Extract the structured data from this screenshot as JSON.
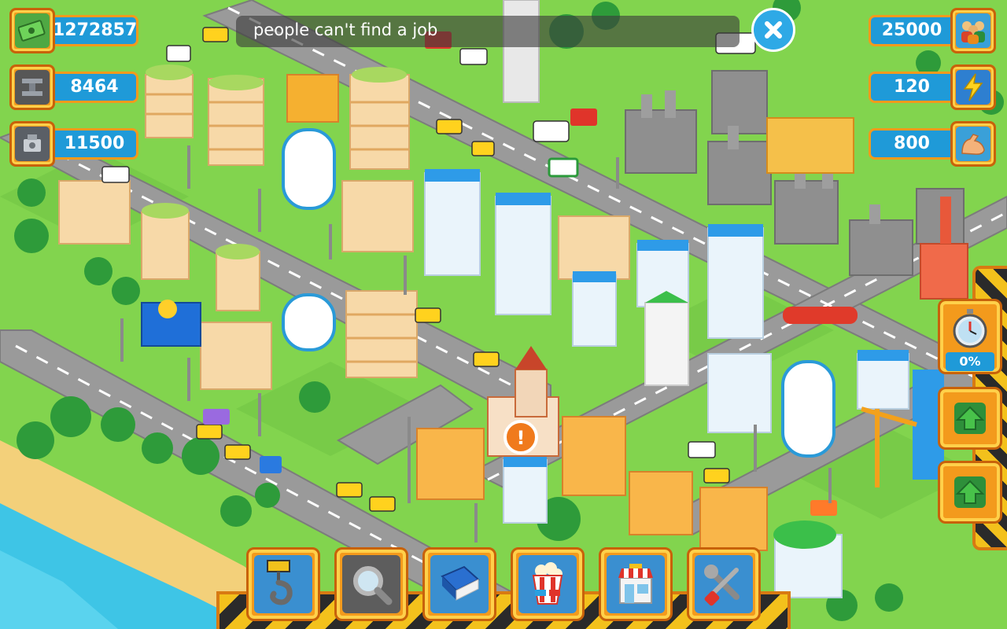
{
  "resources": {
    "money": {
      "value": "1272857",
      "icon": "money-icon"
    },
    "steel": {
      "value": "8464",
      "icon": "steel-beam-icon"
    },
    "machinery": {
      "value": "11500",
      "icon": "engine-icon"
    },
    "population": {
      "value": "25000",
      "icon": "people-icon"
    },
    "energy": {
      "value": "120",
      "icon": "lightning-icon"
    },
    "workforce": {
      "value": "800",
      "icon": "bicep-icon"
    }
  },
  "notification": {
    "message": "people can't find a job"
  },
  "side_panel": {
    "timer_percent": "0%"
  },
  "toolbar": [
    {
      "id": "build",
      "icon": "crane-hook-icon"
    },
    {
      "id": "search",
      "icon": "magnifier-icon"
    },
    {
      "id": "book",
      "icon": "book-icon"
    },
    {
      "id": "cinema",
      "icon": "popcorn-icon"
    },
    {
      "id": "shop",
      "icon": "shop-icon"
    },
    {
      "id": "settings",
      "icon": "tools-icon"
    }
  ],
  "colors": {
    "grass": "#7ad04a",
    "road": "#9a9a9a",
    "water": "#3ec5e6",
    "sand": "#f3d07a",
    "ui_orange": "#f39a1c",
    "ui_blue": "#1f9ad8"
  }
}
